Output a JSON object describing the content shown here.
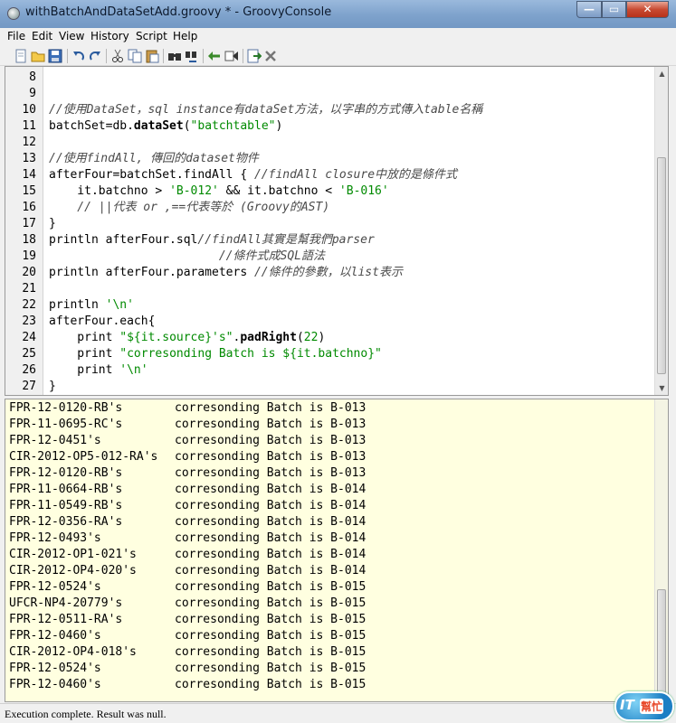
{
  "window": {
    "title": "withBatchAndDataSetAdd.groovy * - GroovyConsole",
    "controls": {
      "minimize": "—",
      "maximize": "▭",
      "close": "✕"
    }
  },
  "menu": [
    "File",
    "Edit",
    "View",
    "History",
    "Script",
    "Help"
  ],
  "toolbar": [
    "new-file-icon",
    "open-file-icon",
    "save-icon",
    "undo-icon",
    "redo-icon",
    "cut-icon",
    "copy-icon",
    "paste-icon",
    "find-icon",
    "replace-icon",
    "history-previous-icon",
    "history-next-icon",
    "run-script-icon",
    "interrupt-icon"
  ],
  "editor": {
    "lines": [
      {
        "num": "8",
        "parts": []
      },
      {
        "num": "9",
        "parts": []
      },
      {
        "num": "10",
        "parts": [
          {
            "t": "c",
            "v": "//使用DataSet，sql instance有dataSet方法，以字串的方式傳入table名稱"
          }
        ]
      },
      {
        "num": "11",
        "parts": [
          {
            "t": "n",
            "v": "batchSet=db."
          },
          {
            "t": "b",
            "v": "dataSet"
          },
          {
            "t": "n",
            "v": "("
          },
          {
            "t": "s",
            "v": "\"batchtable\""
          },
          {
            "t": "n",
            "v": ")"
          }
        ]
      },
      {
        "num": "12",
        "parts": []
      },
      {
        "num": "13",
        "parts": [
          {
            "t": "c",
            "v": "//使用findAll, 傳回的dataset物件"
          }
        ]
      },
      {
        "num": "14",
        "parts": [
          {
            "t": "n",
            "v": "afterFour=batchSet.findAll { "
          },
          {
            "t": "c",
            "v": "//findAll closure中放的是條件式"
          }
        ]
      },
      {
        "num": "15",
        "parts": [
          {
            "t": "n",
            "v": "    it.batchno > "
          },
          {
            "t": "s",
            "v": "'B-012'"
          },
          {
            "t": "n",
            "v": " && it.batchno < "
          },
          {
            "t": "s",
            "v": "'B-016'"
          }
        ]
      },
      {
        "num": "16",
        "parts": [
          {
            "t": "c",
            "v": "    // ||代表 or ,==代表等於 (Groovy的AST)"
          }
        ]
      },
      {
        "num": "17",
        "parts": [
          {
            "t": "n",
            "v": "}"
          }
        ]
      },
      {
        "num": "18",
        "parts": [
          {
            "t": "n",
            "v": "println afterFour.sql"
          },
          {
            "t": "c",
            "v": "//findAll其實是幫我們parser"
          }
        ]
      },
      {
        "num": "19",
        "parts": [
          {
            "t": "c",
            "v": "                        //條件式成SQL語法"
          }
        ]
      },
      {
        "num": "20",
        "parts": [
          {
            "t": "n",
            "v": "println afterFour.parameters "
          },
          {
            "t": "c",
            "v": "//條件的參數，以list表示"
          }
        ]
      },
      {
        "num": "21",
        "parts": []
      },
      {
        "num": "22",
        "parts": [
          {
            "t": "n",
            "v": "println "
          },
          {
            "t": "s",
            "v": "'\\n'"
          }
        ]
      },
      {
        "num": "23",
        "parts": [
          {
            "t": "n",
            "v": "afterFour.each{"
          }
        ]
      },
      {
        "num": "24",
        "parts": [
          {
            "t": "n",
            "v": "    print "
          },
          {
            "t": "s",
            "v": "\"${it.source}'s\""
          },
          {
            "t": "n",
            "v": "."
          },
          {
            "t": "b",
            "v": "padRight"
          },
          {
            "t": "n",
            "v": "("
          },
          {
            "t": "s",
            "v": "22"
          },
          {
            "t": "n",
            "v": ")"
          }
        ]
      },
      {
        "num": "25",
        "parts": [
          {
            "t": "n",
            "v": "    print "
          },
          {
            "t": "s",
            "v": "\"corresonding Batch is ${it.batchno}\""
          }
        ]
      },
      {
        "num": "26",
        "parts": [
          {
            "t": "n",
            "v": "    print "
          },
          {
            "t": "s",
            "v": "'\\n'"
          }
        ]
      },
      {
        "num": "27",
        "parts": [
          {
            "t": "n",
            "v": "}"
          }
        ]
      }
    ]
  },
  "output": {
    "rows": [
      {
        "file": "FPR-12-0120-RB's",
        "text": "corresonding Batch is B-013"
      },
      {
        "file": "FPR-11-0695-RC's",
        "text": "corresonding Batch is B-013"
      },
      {
        "file": "FPR-12-0451's",
        "text": "corresonding Batch is B-013"
      },
      {
        "file": "CIR-2012-OP5-012-RA's",
        "text": "corresonding Batch is B-013"
      },
      {
        "file": "FPR-12-0120-RB's",
        "text": "corresonding Batch is B-013"
      },
      {
        "file": "FPR-11-0664-RB's",
        "text": "corresonding Batch is B-014"
      },
      {
        "file": "FPR-11-0549-RB's",
        "text": "corresonding Batch is B-014"
      },
      {
        "file": "FPR-12-0356-RA's",
        "text": "corresonding Batch is B-014"
      },
      {
        "file": "FPR-12-0493's",
        "text": "corresonding Batch is B-014"
      },
      {
        "file": "CIR-2012-OP1-021's",
        "text": "corresonding Batch is B-014"
      },
      {
        "file": "CIR-2012-OP4-020's",
        "text": "corresonding Batch is B-014"
      },
      {
        "file": "FPR-12-0524's",
        "text": "corresonding Batch is B-015"
      },
      {
        "file": "UFCR-NP4-20779's",
        "text": "corresonding Batch is B-015"
      },
      {
        "file": "FPR-12-0511-RA's",
        "text": "corresonding Batch is B-015"
      },
      {
        "file": "FPR-12-0460's",
        "text": "corresonding Batch is B-015"
      },
      {
        "file": "CIR-2012-OP4-018's",
        "text": "corresonding Batch is B-015"
      },
      {
        "file": "FPR-12-0524's",
        "text": "corresonding Batch is B-015"
      },
      {
        "file": "FPR-12-0460's",
        "text": "corresonding Batch is B-015"
      }
    ]
  },
  "status": "Execution complete. Result was null.",
  "logo": {
    "it": "IT",
    "cn": "幫忙"
  },
  "colors": {
    "code_string": "#008a00",
    "code_comment": "#4a4a4a",
    "output_bg": "#ffffe0",
    "close_button": "#c84a32"
  }
}
